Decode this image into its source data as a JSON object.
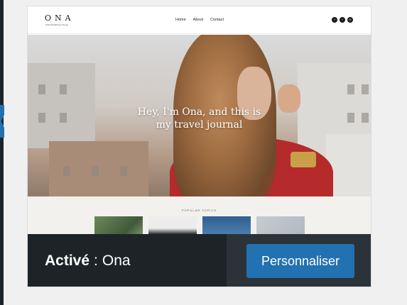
{
  "theme_preview": {
    "logo": "ONA",
    "tagline": "ONA WordPress Theme",
    "nav": [
      "Home",
      "About",
      "Contact"
    ],
    "social_icons": [
      "facebook-icon",
      "twitter-icon",
      "instagram-icon"
    ],
    "hero_line1": "Hey, I'm Ona, and this is",
    "hero_line2": "my travel journal",
    "section_label": "POPULAR TOPICS"
  },
  "theme_bar": {
    "status_label": "Activé",
    "separator": ":",
    "theme_name": "Ona",
    "customize_label": "Personnaliser"
  },
  "colors": {
    "bar_bg": "#1d2327",
    "actions_bg": "#2c3338",
    "button": "#2271b1"
  }
}
